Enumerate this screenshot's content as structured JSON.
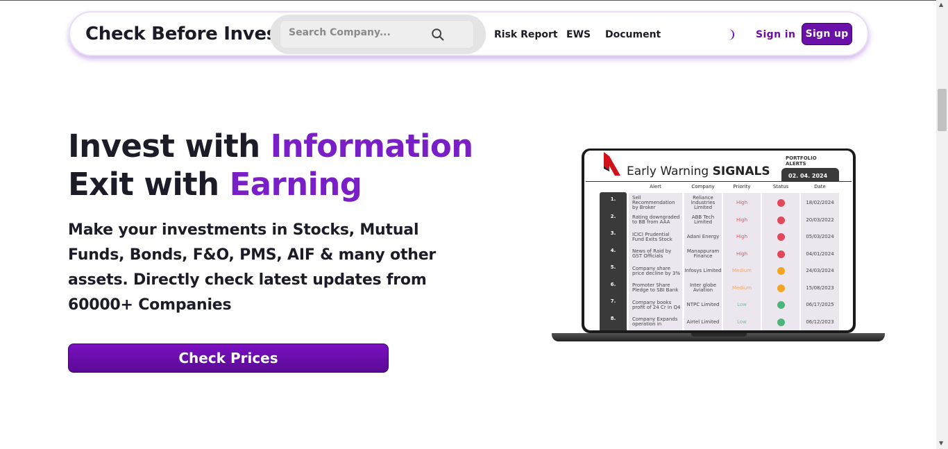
{
  "navbar": {
    "brand": "Check Before Invest",
    "search_placeholder": "Search Company...",
    "links": [
      "Risk Report",
      "EWS",
      "Document"
    ],
    "signin": "Sign in",
    "signup": "Sign up"
  },
  "hero": {
    "line1_prefix": "Invest with ",
    "line1_accent": "Information",
    "line2_prefix": "Exit with ",
    "line2_accent": "Earning",
    "subtext": "Make your investments in Stocks, Mutual Funds, Bonds, F&O, PMS, AIF & many other assets. Directly check latest updates from 60000+ Companies",
    "cta": "Check Prices"
  },
  "ews_card": {
    "title_light": "Early Warning ",
    "title_bold": "SIGNALS",
    "portfolio_label": "PORTFOLIO ALERTS",
    "date": "02. 04. 2024",
    "headers": [
      "Alert",
      "Company",
      "Priority",
      "Status",
      "Date"
    ],
    "rows": [
      {
        "num": "1.",
        "alert": "Sell Recommendation by Broker",
        "company": "Reliance Industries Limited",
        "priority": "High",
        "priority_color": "#e0555f",
        "status_color": "#e2485a",
        "date": "18/02/2024"
      },
      {
        "num": "2.",
        "alert": "Rating downgraded to BB from AAA",
        "company": "ABB Tech Limited",
        "priority": "High",
        "priority_color": "#e0555f",
        "status_color": "#e2485a",
        "date": "20/03/2022"
      },
      {
        "num": "3.",
        "alert": "ICICI Prudential Fund Exits Stock",
        "company": "Adani Energy",
        "priority": "High",
        "priority_color": "#e0555f",
        "status_color": "#e2485a",
        "date": "05/03/2024"
      },
      {
        "num": "4.",
        "alert": "News of Raid by GST Officials",
        "company": "Manappuram Finance",
        "priority": "High",
        "priority_color": "#e0555f",
        "status_color": "#e2485a",
        "date": "04/01/2024"
      },
      {
        "num": "5.",
        "alert": "Company share price decline by 3%",
        "company": "Infosys Limited",
        "priority": "Medium",
        "priority_color": "#f0a66a",
        "status_color": "#f4a423",
        "date": "24/03/2024"
      },
      {
        "num": "6.",
        "alert": "Promoter Share Pledge to SBI Bank",
        "company": "Inter globe Aviation",
        "priority": "Medium",
        "priority_color": "#f0a66a",
        "status_color": "#f4a423",
        "date": "15/08/2023"
      },
      {
        "num": "7.",
        "alert": "Company books profit of 24 Cr in Q4",
        "company": "NTPC Limited",
        "priority": "Low",
        "priority_color": "#6cc49a",
        "status_color": "#4cb67a",
        "date": "06/17/2025"
      },
      {
        "num": "8.",
        "alert": "Company Expands operation in",
        "company": "Airtel Limited",
        "priority": "Low",
        "priority_color": "#6cc49a",
        "status_color": "#4cb67a",
        "date": "06/12/2023"
      }
    ]
  },
  "colors": {
    "accent": "#7a1fc8",
    "button": "#6a0fa8"
  }
}
